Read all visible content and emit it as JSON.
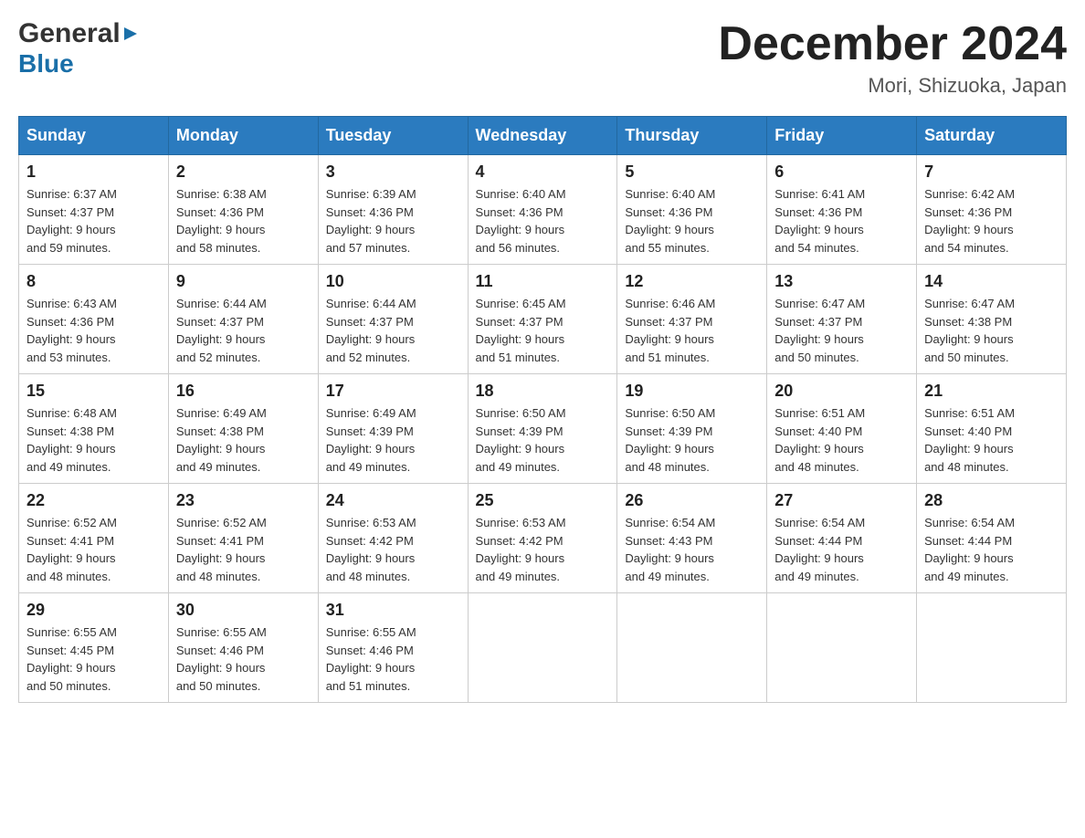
{
  "header": {
    "logo_general": "General",
    "logo_blue": "Blue",
    "month_title": "December 2024",
    "location": "Mori, Shizuoka, Japan"
  },
  "days_of_week": [
    "Sunday",
    "Monday",
    "Tuesday",
    "Wednesday",
    "Thursday",
    "Friday",
    "Saturday"
  ],
  "weeks": [
    [
      {
        "num": "1",
        "sunrise": "6:37 AM",
        "sunset": "4:37 PM",
        "daylight": "9 hours and 59 minutes."
      },
      {
        "num": "2",
        "sunrise": "6:38 AM",
        "sunset": "4:36 PM",
        "daylight": "9 hours and 58 minutes."
      },
      {
        "num": "3",
        "sunrise": "6:39 AM",
        "sunset": "4:36 PM",
        "daylight": "9 hours and 57 minutes."
      },
      {
        "num": "4",
        "sunrise": "6:40 AM",
        "sunset": "4:36 PM",
        "daylight": "9 hours and 56 minutes."
      },
      {
        "num": "5",
        "sunrise": "6:40 AM",
        "sunset": "4:36 PM",
        "daylight": "9 hours and 55 minutes."
      },
      {
        "num": "6",
        "sunrise": "6:41 AM",
        "sunset": "4:36 PM",
        "daylight": "9 hours and 54 minutes."
      },
      {
        "num": "7",
        "sunrise": "6:42 AM",
        "sunset": "4:36 PM",
        "daylight": "9 hours and 54 minutes."
      }
    ],
    [
      {
        "num": "8",
        "sunrise": "6:43 AM",
        "sunset": "4:36 PM",
        "daylight": "9 hours and 53 minutes."
      },
      {
        "num": "9",
        "sunrise": "6:44 AM",
        "sunset": "4:37 PM",
        "daylight": "9 hours and 52 minutes."
      },
      {
        "num": "10",
        "sunrise": "6:44 AM",
        "sunset": "4:37 PM",
        "daylight": "9 hours and 52 minutes."
      },
      {
        "num": "11",
        "sunrise": "6:45 AM",
        "sunset": "4:37 PM",
        "daylight": "9 hours and 51 minutes."
      },
      {
        "num": "12",
        "sunrise": "6:46 AM",
        "sunset": "4:37 PM",
        "daylight": "9 hours and 51 minutes."
      },
      {
        "num": "13",
        "sunrise": "6:47 AM",
        "sunset": "4:37 PM",
        "daylight": "9 hours and 50 minutes."
      },
      {
        "num": "14",
        "sunrise": "6:47 AM",
        "sunset": "4:38 PM",
        "daylight": "9 hours and 50 minutes."
      }
    ],
    [
      {
        "num": "15",
        "sunrise": "6:48 AM",
        "sunset": "4:38 PM",
        "daylight": "9 hours and 49 minutes."
      },
      {
        "num": "16",
        "sunrise": "6:49 AM",
        "sunset": "4:38 PM",
        "daylight": "9 hours and 49 minutes."
      },
      {
        "num": "17",
        "sunrise": "6:49 AM",
        "sunset": "4:39 PM",
        "daylight": "9 hours and 49 minutes."
      },
      {
        "num": "18",
        "sunrise": "6:50 AM",
        "sunset": "4:39 PM",
        "daylight": "9 hours and 49 minutes."
      },
      {
        "num": "19",
        "sunrise": "6:50 AM",
        "sunset": "4:39 PM",
        "daylight": "9 hours and 48 minutes."
      },
      {
        "num": "20",
        "sunrise": "6:51 AM",
        "sunset": "4:40 PM",
        "daylight": "9 hours and 48 minutes."
      },
      {
        "num": "21",
        "sunrise": "6:51 AM",
        "sunset": "4:40 PM",
        "daylight": "9 hours and 48 minutes."
      }
    ],
    [
      {
        "num": "22",
        "sunrise": "6:52 AM",
        "sunset": "4:41 PM",
        "daylight": "9 hours and 48 minutes."
      },
      {
        "num": "23",
        "sunrise": "6:52 AM",
        "sunset": "4:41 PM",
        "daylight": "9 hours and 48 minutes."
      },
      {
        "num": "24",
        "sunrise": "6:53 AM",
        "sunset": "4:42 PM",
        "daylight": "9 hours and 48 minutes."
      },
      {
        "num": "25",
        "sunrise": "6:53 AM",
        "sunset": "4:42 PM",
        "daylight": "9 hours and 49 minutes."
      },
      {
        "num": "26",
        "sunrise": "6:54 AM",
        "sunset": "4:43 PM",
        "daylight": "9 hours and 49 minutes."
      },
      {
        "num": "27",
        "sunrise": "6:54 AM",
        "sunset": "4:44 PM",
        "daylight": "9 hours and 49 minutes."
      },
      {
        "num": "28",
        "sunrise": "6:54 AM",
        "sunset": "4:44 PM",
        "daylight": "9 hours and 49 minutes."
      }
    ],
    [
      {
        "num": "29",
        "sunrise": "6:55 AM",
        "sunset": "4:45 PM",
        "daylight": "9 hours and 50 minutes."
      },
      {
        "num": "30",
        "sunrise": "6:55 AM",
        "sunset": "4:46 PM",
        "daylight": "9 hours and 50 minutes."
      },
      {
        "num": "31",
        "sunrise": "6:55 AM",
        "sunset": "4:46 PM",
        "daylight": "9 hours and 51 minutes."
      },
      null,
      null,
      null,
      null
    ]
  ],
  "labels": {
    "sunrise_prefix": "Sunrise: ",
    "sunset_prefix": "Sunset: ",
    "daylight_prefix": "Daylight: "
  }
}
